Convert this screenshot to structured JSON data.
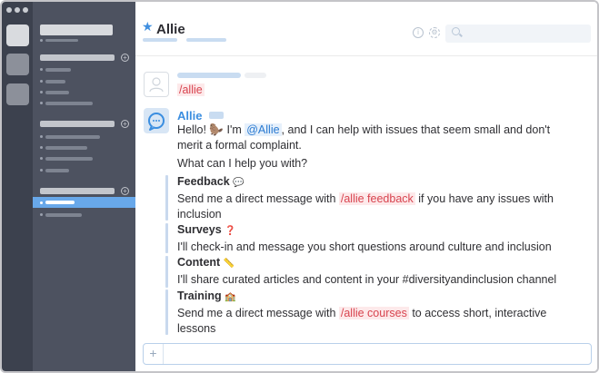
{
  "channel": {
    "title": "Allie"
  },
  "user_message": {
    "command": "/allie"
  },
  "bot_message": {
    "name": "Allie",
    "greeting_prefix": "Hello! 🦫 I'm",
    "mention": "@Allie",
    "greeting_suffix": ", and I can help with issues that seem small and don't",
    "greeting_line2": "merit a formal complaint.",
    "question": "What can I help you with?"
  },
  "sections": [
    {
      "title": "Feedback",
      "emoji": "💬",
      "text_prefix": "Send me a direct message with",
      "command": "/allie feedback",
      "text_suffix": "if you have any issues with",
      "text_line2": "inclusion"
    },
    {
      "title": "Surveys",
      "emoji": "❓",
      "text": "I'll check-in and message you short questions around culture and inclusion"
    },
    {
      "title": "Content",
      "emoji": "📏",
      "text": "I'll share curated articles and content in your #diversityandinclusion channel"
    },
    {
      "title": "Training",
      "emoji": "🏫",
      "text_prefix": "Send me a direct message with",
      "command": "/allie courses",
      "text_suffix": "to access short, interactive",
      "text_line2": "lessons"
    }
  ],
  "composer": {
    "plus_label": "+"
  },
  "header_icons": [
    "info-icon",
    "gear-icon",
    "search-icon"
  ],
  "colors": {
    "accent": "#3b8ee0",
    "command": "#d8444f",
    "sidebar": "#4d5260",
    "rail": "#3c414e",
    "selected": "#68a8ea"
  }
}
